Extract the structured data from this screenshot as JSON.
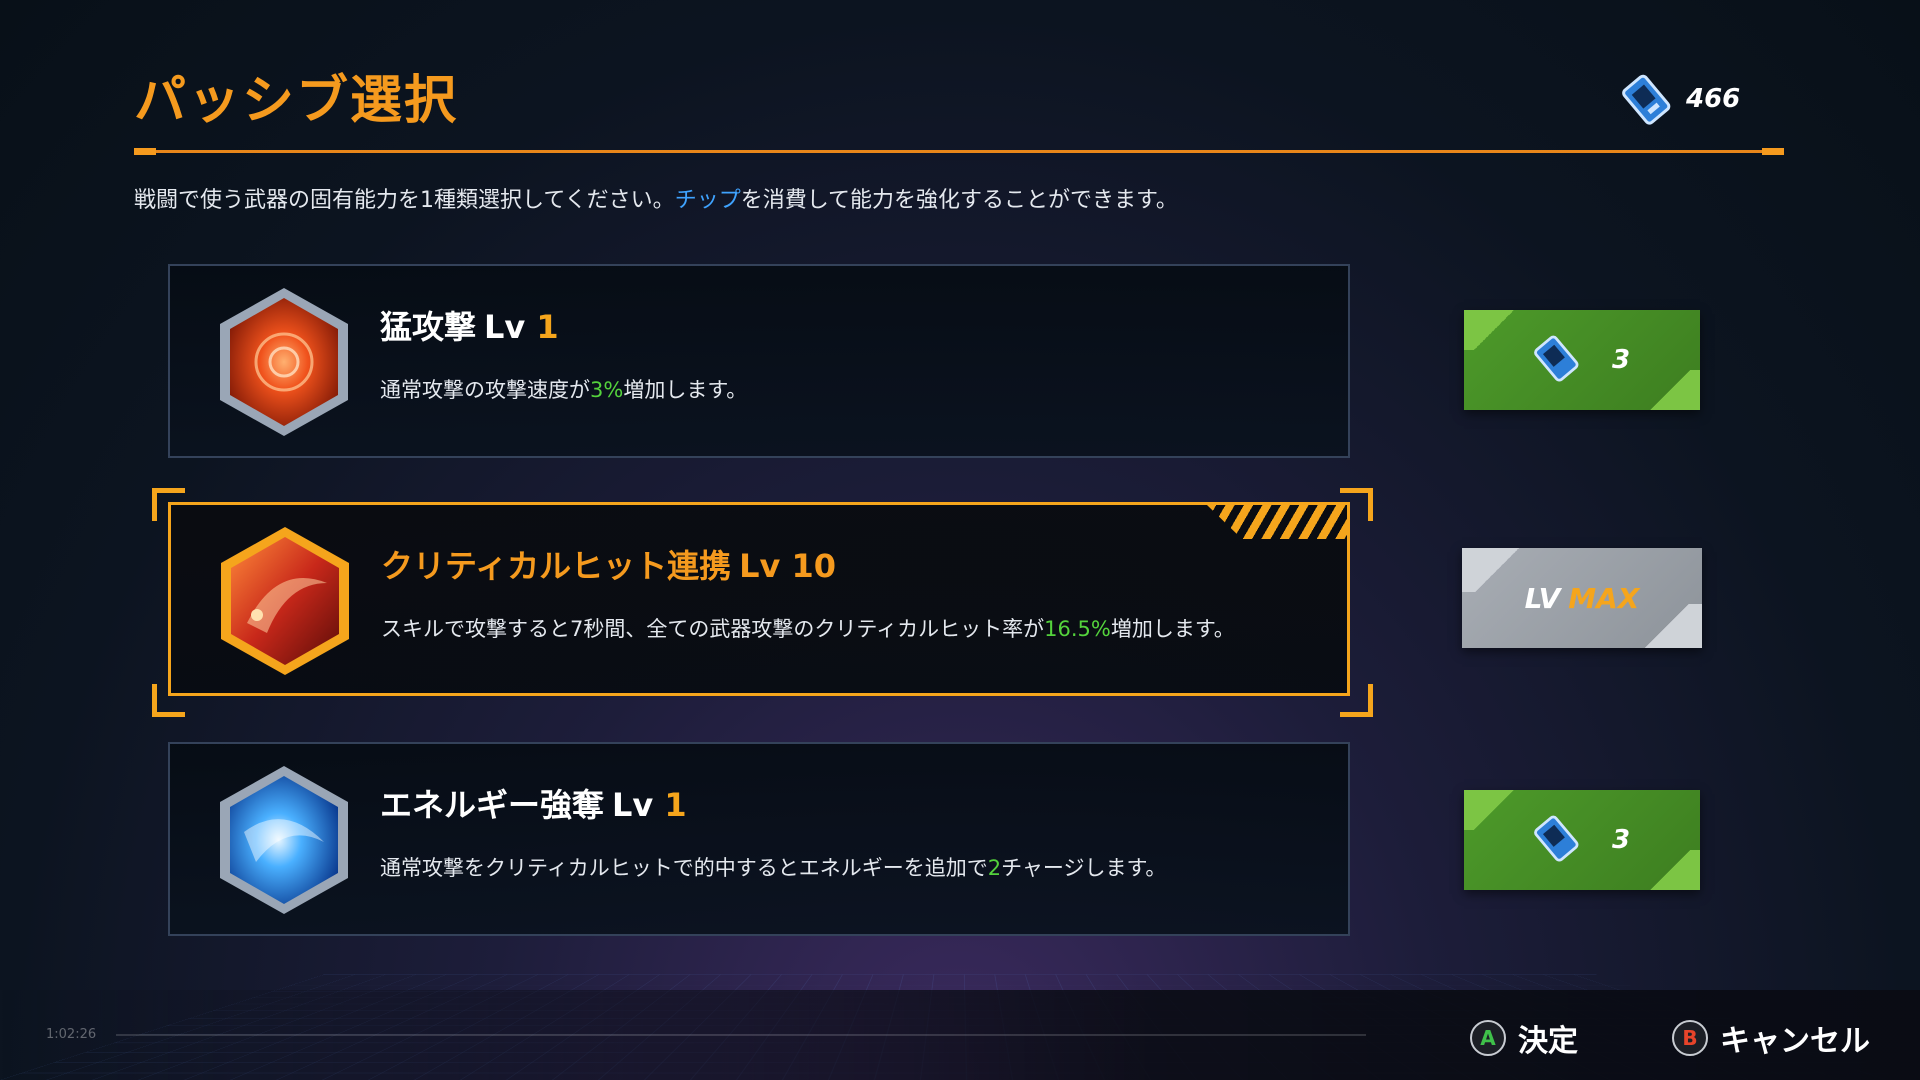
{
  "header": {
    "title": "パッシブ選択",
    "currency": {
      "icon": "chip-icon",
      "value": "466"
    }
  },
  "description": {
    "before": "戦闘で使う武器の固有能力を1種類選択してください。",
    "highlight": "チップ",
    "after": "を消費して能力を強化することができます。"
  },
  "skills": [
    {
      "name": "猛攻撃",
      "lv_label": "Lv",
      "level": "1",
      "desc_before": "通常攻撃の攻撃速度が",
      "desc_value": "3%",
      "desc_after": "増加します。",
      "icon": "fierce-attack-icon",
      "action": {
        "type": "upgrade",
        "cost": "3"
      }
    },
    {
      "name": "クリティカルヒット連携",
      "lv_label": "Lv",
      "level": "10",
      "desc_before": "スキルで攻撃すると7秒間、全ての武器攻撃のクリティカルヒット率が",
      "desc_value": "16.5%",
      "desc_after": "増加します。",
      "icon": "critical-chain-icon",
      "selected": true,
      "action": {
        "type": "max",
        "lv_text": "LV",
        "max_text": "MAX"
      }
    },
    {
      "name": "エネルギー強奪",
      "lv_label": "Lv",
      "level": "1",
      "desc_before": "通常攻撃をクリティカルヒットで的中するとエネルギーを追加で",
      "desc_value": "2",
      "desc_after": "チャージします。",
      "icon": "energy-steal-icon",
      "action": {
        "type": "upgrade",
        "cost": "3"
      }
    }
  ],
  "footer": {
    "timestamp": "1:02:26",
    "confirm": {
      "button": "A",
      "label": "決定"
    },
    "cancel": {
      "button": "B",
      "label": "キャンセル"
    }
  },
  "colors": {
    "accent": "#f59a1e",
    "highlight_blue": "#3fa3ff",
    "highlight_green": "#54d23c",
    "upgrade_green": "#4d9a2a",
    "max_gray": "#a8adb4"
  }
}
